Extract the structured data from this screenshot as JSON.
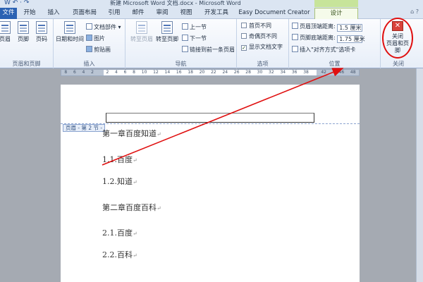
{
  "window": {
    "title": "新建 Microsoft Word 文档.docx - Microsoft Word",
    "context_tab_group": "页眉和页脚工具",
    "qa_icons": "W ↶ · ↷"
  },
  "tabs": [
    "文件",
    "开始",
    "插入",
    "页面布局",
    "引用",
    "邮件",
    "审阅",
    "视图",
    "开发工具",
    "Easy Document Creator",
    "设计"
  ],
  "tab_icons": "⌂ ?",
  "ribbon": {
    "group_header_footer": {
      "label": "页眉和页脚",
      "header": "页眉",
      "footer": "页脚",
      "page_number": "页码"
    },
    "group_insert": {
      "label": "插入",
      "datetime": "日期和时间",
      "docparts": "文档部件 ▾",
      "picture": "图片",
      "clipart": "剪贴画"
    },
    "group_nav": {
      "label": "导航",
      "goto_header": "转至页眉",
      "goto_footer": "转至页脚",
      "prev": "上一节",
      "next": "下一节",
      "link_prev": "链接到前一条页眉"
    },
    "group_options": {
      "label": "选项",
      "diff_first": "首页不同",
      "diff_odd_even": "奇偶页不同",
      "show_text": "显示文档文字"
    },
    "group_position": {
      "label": "位置",
      "header_from_top_label": "页眉顶端距离:",
      "header_from_top_value": "1.5 厘米",
      "footer_from_bottom_label": "页脚底端距离:",
      "footer_from_bottom_value": "1.75 厘米",
      "insert_align_tab": "插入\"对齐方式\"选项卡"
    },
    "group_close": {
      "label": "关闭",
      "close_line1": "关闭",
      "close_line2": "页眉和页脚",
      "close_glyph": "✕"
    }
  },
  "ruler": {
    "ticks": [
      "8",
      "6",
      "4",
      "2",
      "",
      "2",
      "4",
      "6",
      "8",
      "10",
      "12",
      "14",
      "16",
      "18",
      "20",
      "22",
      "24",
      "26",
      "28",
      "30",
      "32",
      "34",
      "36",
      "38",
      "",
      "42",
      "",
      "46",
      "48"
    ]
  },
  "document": {
    "header_tag": "页眉 - 第 2 节 -",
    "header_mark": "·",
    "lines": [
      {
        "text": "第一章百度知道",
        "mark": "↵"
      },
      {
        "text": "1.1.百度",
        "mark": "↵"
      },
      {
        "text": "1.2.知道",
        "mark": "↵"
      },
      {
        "text": "第二章百度百科",
        "mark": "↵"
      },
      {
        "text": "2.1.百度",
        "mark": "↵"
      },
      {
        "text": "2.2.百科",
        "mark": "↵"
      }
    ]
  },
  "annotation": {
    "color": "#e01010"
  }
}
